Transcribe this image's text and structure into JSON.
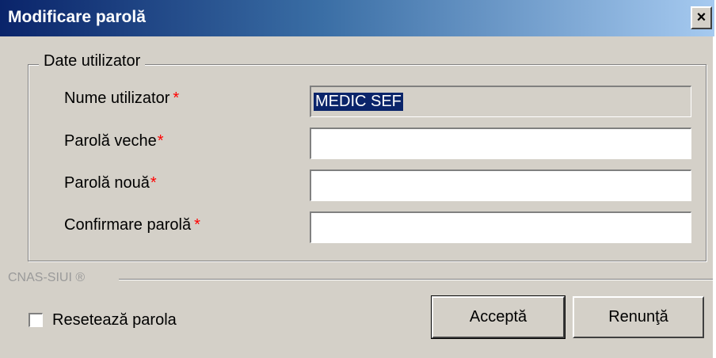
{
  "window": {
    "title": "Modificare parolă",
    "close_glyph": "×"
  },
  "group": {
    "legend": "Date utilizator",
    "required_marker": "*",
    "fields": [
      {
        "label": "Nume utilizator",
        "value": "MEDIC SEF",
        "readonly": true
      },
      {
        "label": "Parolă veche",
        "value": ""
      },
      {
        "label": "Parolă nouă",
        "value": ""
      },
      {
        "label": "Confirmare parolă",
        "value": ""
      }
    ]
  },
  "footer": {
    "brand": "CNAS-SIUI ®",
    "reset_checkbox_label": "Resetează parola",
    "reset_checked": false,
    "accept_label": "Acceptă",
    "cancel_label": "Renunţă"
  },
  "colors": {
    "title_gradient_start": "#0a246a",
    "title_gradient_end": "#a6caf0",
    "dialog_bg": "#d4d0c8",
    "required": "#ff0000",
    "selection_bg": "#0a246a"
  }
}
